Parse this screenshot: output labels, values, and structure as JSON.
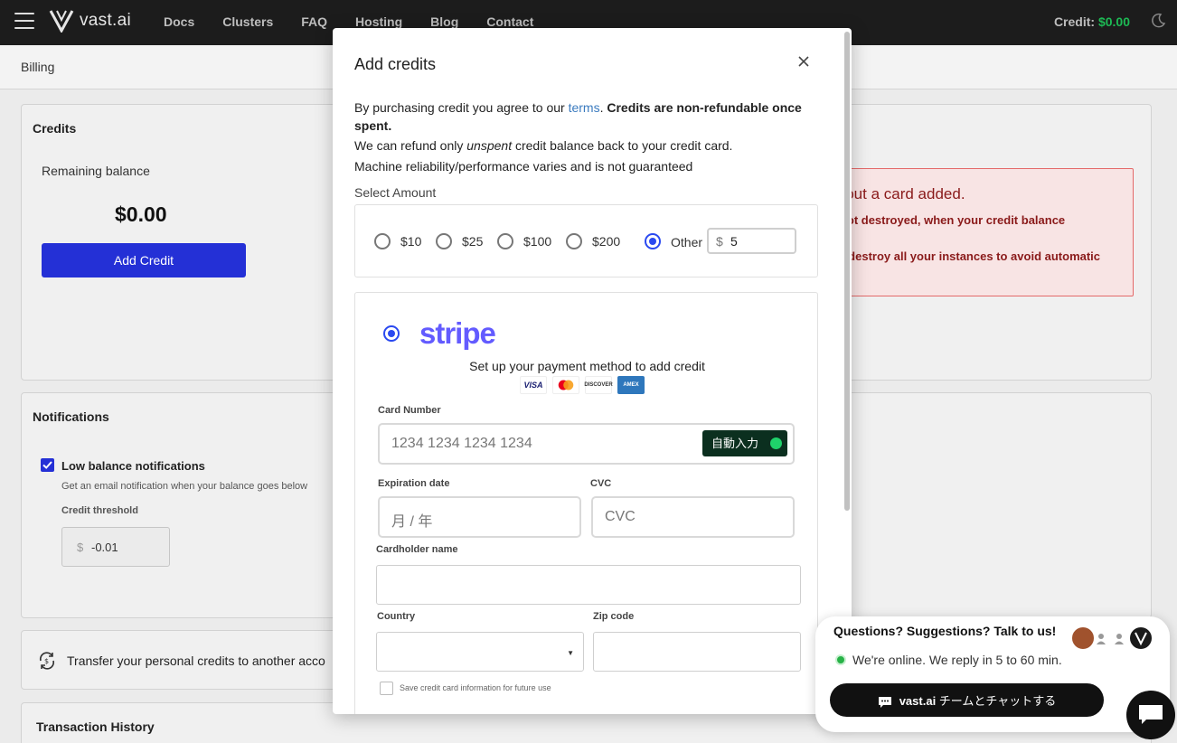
{
  "nav": {
    "brand": "vast.ai",
    "links": [
      "Docs",
      "Clusters",
      "FAQ",
      "Hosting",
      "Blog",
      "Contact"
    ],
    "credit_label": "Credit:",
    "credit_amount": "$0.00"
  },
  "page": {
    "breadcrumb": "Billing",
    "credits": {
      "title": "Credits",
      "remaining_label": "Remaining balance",
      "balance": "$0.00",
      "add_button": "Add Credit",
      "warning_title": "without a card added.",
      "warning_line1": "t not destroyed, when your credit balance",
      "warning_line2": "st destroy all your instances to avoid automatic"
    },
    "notifications": {
      "title": "Notifications",
      "low_balance_label": "Low balance notifications",
      "low_balance_desc": "Get an email notification when your balance goes below",
      "threshold_label": "Credit threshold",
      "threshold_currency": "$",
      "threshold_value": "-0.01"
    },
    "transfer_text": "Transfer your personal credits to another acco",
    "history_title": "Transaction History"
  },
  "modal": {
    "title": "Add credits",
    "terms_prefix": "By purchasing credit you agree to our ",
    "terms_link": "terms",
    "terms_bold": "Credits are non-refundable once spent.",
    "refund_prefix": "We can refund only ",
    "refund_em": "unspent",
    "refund_suffix": " credit balance back to your credit card.",
    "reliability": "Machine reliability/performance varies and is not guaranteed",
    "select_amount": "Select Amount",
    "amounts": [
      "$10",
      "$25",
      "$100",
      "$200"
    ],
    "other_label": "Other",
    "other_currency": "$",
    "other_value": "5",
    "stripe": {
      "logo": "stripe",
      "setup_text": "Set up your payment method to add credit",
      "card_brands": [
        "VISA",
        "",
        "DISCOVER",
        "AMEX"
      ],
      "card_number_label": "Card Number",
      "card_number_placeholder": "1234 1234 1234 1234",
      "autofill": "自動入力",
      "expiry_label": "Expiration date",
      "expiry_placeholder": "月 / 年",
      "cvc_label": "CVC",
      "cvc_placeholder": "CVC",
      "cardholder_label": "Cardholder name",
      "country_label": "Country",
      "zip_label": "Zip code",
      "save_label": "Save credit card information for future use"
    }
  },
  "chat": {
    "title": "Questions? Suggestions? Talk to us!",
    "status": "We're online. We reply in 5 to 60 min.",
    "brand": "vast.ai",
    "button_suffix": " チームとチャットする"
  },
  "colors": {
    "primary": "#2430d6",
    "stripe": "#635bff",
    "credit_green": "#1db954",
    "warning_red": "#e46a6a"
  }
}
